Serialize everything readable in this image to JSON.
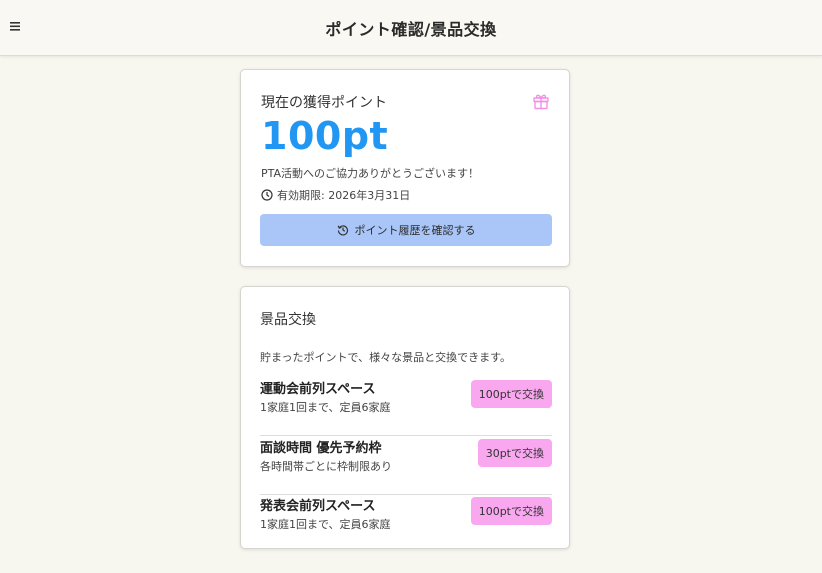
{
  "header": {
    "title": "ポイント確認/景品交換",
    "menu_icon": "hamburger-menu-icon"
  },
  "points_card": {
    "title": "現在の獲得ポイント",
    "icon": "gift-icon",
    "points": "100pt",
    "thanks": "PTA活動へのご協力ありがとうございます！",
    "expiry": "有効期限: 2026年3月31日",
    "history_button": "ポイント履歴を確認する"
  },
  "rewards_card": {
    "title": "景品交換",
    "description": "貯まったポイントで、様々な景品と交換できます。",
    "items": [
      {
        "name": "運動会前列スペース",
        "note": "1家庭1回まで、定員6家庭",
        "button": "100ptで交換"
      },
      {
        "name": "面談時間 優先予約枠",
        "note": "各時間帯ごとに枠制限あり",
        "button": "30ptで交換"
      },
      {
        "name": "発表会前列スペース",
        "note": "1家庭1回まで、定員6家庭",
        "button": "100ptで交換"
      }
    ]
  },
  "colors": {
    "background": "#f7f6ef",
    "points_accent": "#2196f3",
    "history_button": "#aac6f8",
    "exchange_button": "#f9a8f0",
    "gift_icon": "#f48fe6"
  }
}
